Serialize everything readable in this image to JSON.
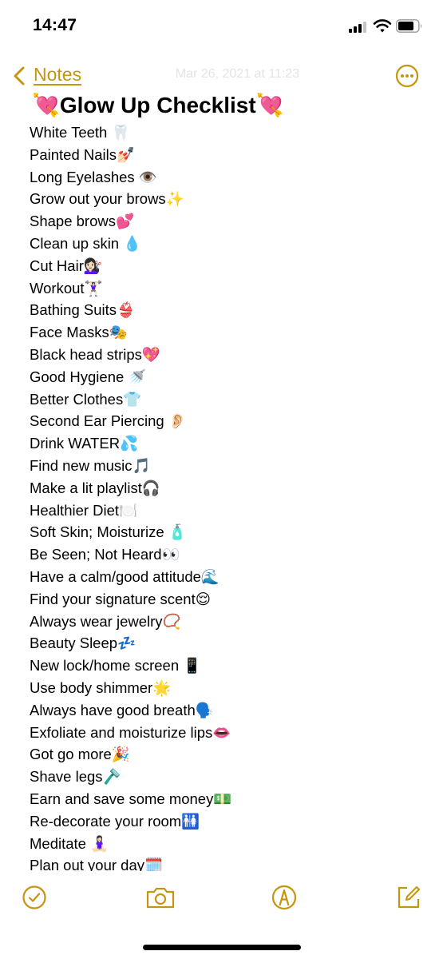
{
  "status_bar": {
    "time": "14:47",
    "signal_bars_active": 3,
    "signal_bars_total": 4
  },
  "nav": {
    "back_label": "Notes",
    "date": "Mar 26, 2021 at 11:23",
    "accent_color": "#c6950f"
  },
  "note": {
    "title": "💘Glow Up Checklist💘",
    "items": [
      "White Teeth 🦷",
      "Painted Nails💅🏻",
      "Long Eyelashes 👁️",
      "Grow out your brows✨",
      "Shape brows💕",
      "Clean up skin 💧",
      "Cut Hair💇🏻‍♀️",
      "Workout🏋🏻‍♀️",
      "Bathing Suits👙",
      "Face Masks🎭",
      "Black head strips💖",
      "Good Hygiene 🚿",
      "Better Clothes👕",
      "Second Ear Piercing 👂🏻",
      "Drink WATER💦",
      "Find new music🎵",
      "Make a lit playlist🎧",
      "Healthier Diet🍽️",
      "Soft Skin; Moisturize 🧴",
      "Be Seen; Not Heard👀",
      "Have a calm/good attitude🌊",
      "Find your signature scent😌",
      "Always wear jewelry📿",
      "Beauty Sleep💤",
      "New lock/home screen 📱",
      "Use body shimmer🌟",
      "Always have good breath🗣️",
      "Exfoliate and moisturize lips👄",
      "Got go more🎉",
      "Shave legs🪒",
      "Earn and save some money💵",
      "Re-decorate your room🚻",
      "Meditate 🧘🏻‍♀️",
      "Plan out your day🗓️"
    ]
  },
  "toolbar": {
    "icons": [
      "checklist-icon",
      "camera-icon",
      "markup-pen-icon",
      "compose-icon"
    ]
  }
}
